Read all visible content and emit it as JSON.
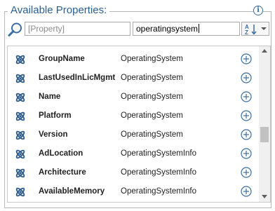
{
  "panel": {
    "title": "Available Properties:",
    "info_icon": "info-icon",
    "info_glyph": "i"
  },
  "filters": {
    "property_placeholder": "[Property]",
    "type_value": "operatingsystem",
    "sort_icon": "sort-az-icon"
  },
  "colors": {
    "title": "#2a5f93",
    "icon_blue": "#2d5a8c",
    "add_icon": "#3a6ea5"
  },
  "properties": [
    {
      "name": "GroupName",
      "type": "OperatingSystem"
    },
    {
      "name": "LastUsedInLicMgmt",
      "type": "OperatingSystem"
    },
    {
      "name": "Name",
      "type": "OperatingSystem"
    },
    {
      "name": "Platform",
      "type": "OperatingSystem"
    },
    {
      "name": "Version",
      "type": "OperatingSystem"
    },
    {
      "name": "AdLocation",
      "type": "OperatingSystemInfo"
    },
    {
      "name": "Architecture",
      "type": "OperatingSystemInfo"
    },
    {
      "name": "AvailableMemory",
      "type": "OperatingSystemInfo"
    }
  ]
}
